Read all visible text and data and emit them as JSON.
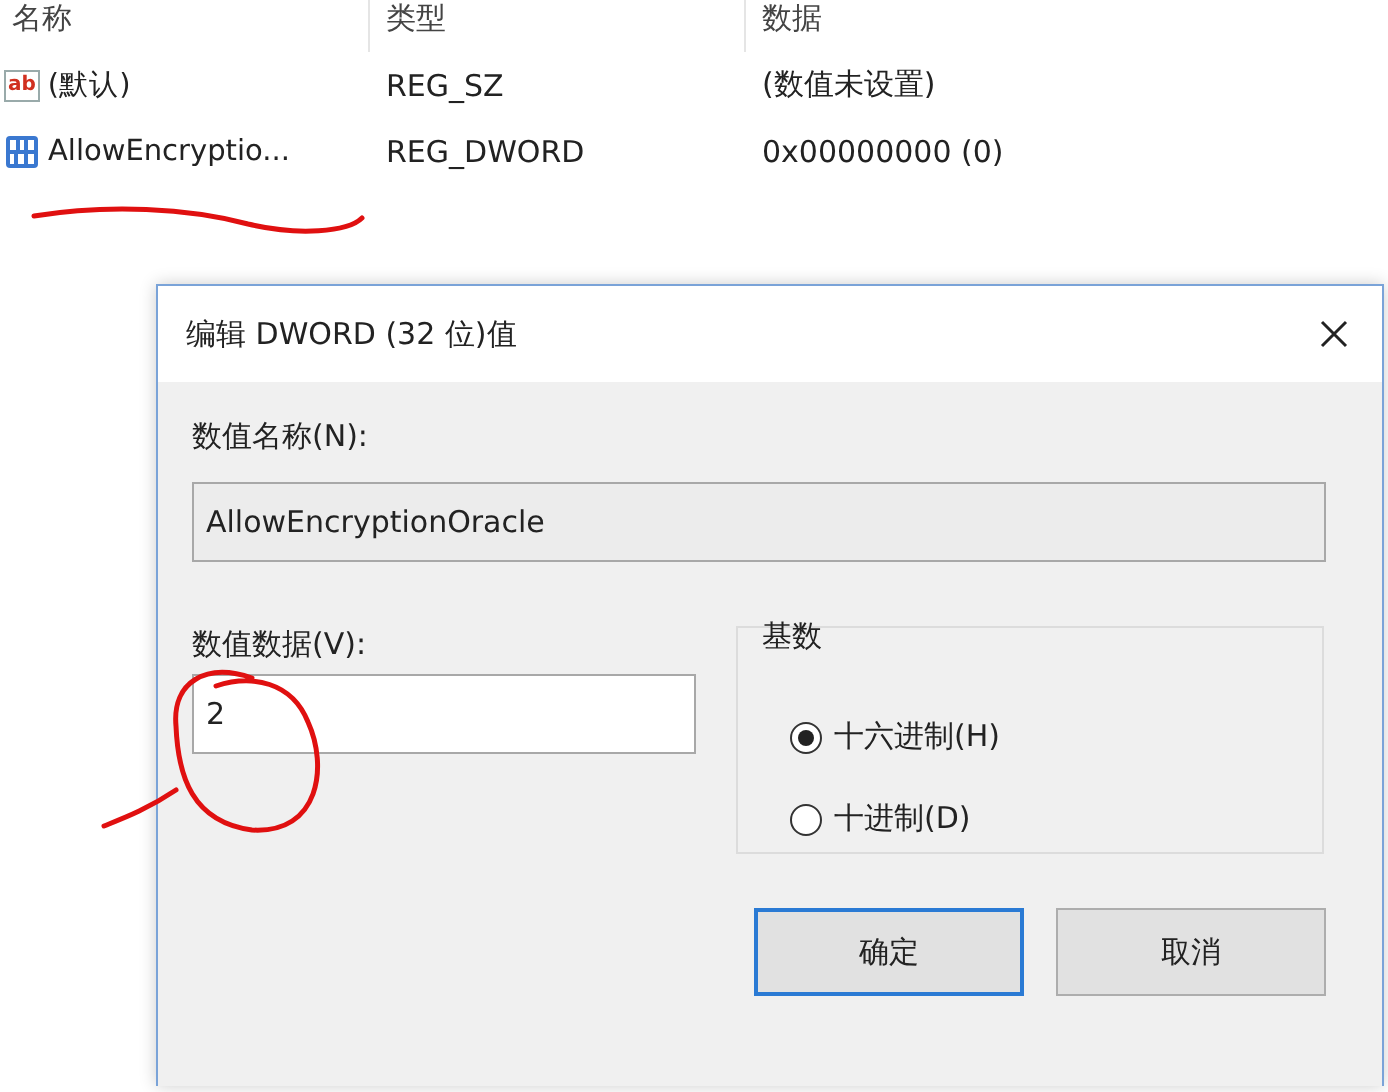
{
  "list": {
    "columns": [
      "名称",
      "类型",
      "数据"
    ],
    "rows": [
      {
        "kind": "string",
        "icon_text": "ab",
        "name": "(默认)",
        "type": "REG_SZ",
        "data": "(数值未设置)"
      },
      {
        "kind": "dword",
        "name": "AllowEncryptio...",
        "type": "REG_DWORD",
        "data": "0x00000000 (0)"
      }
    ]
  },
  "dialog": {
    "title": "编辑 DWORD (32 位)值",
    "name_label": "数值名称(N):",
    "name_value": "AllowEncryptionOracle",
    "data_label": "数值数据(V):",
    "data_value": "2",
    "base_label": "基数",
    "base_options": [
      {
        "label": "十六进制(H)",
        "selected": true
      },
      {
        "label": "十进制(D)",
        "selected": false
      }
    ],
    "buttons": [
      {
        "label": "确定",
        "default": true
      },
      {
        "label": "取消",
        "default": false
      }
    ]
  }
}
